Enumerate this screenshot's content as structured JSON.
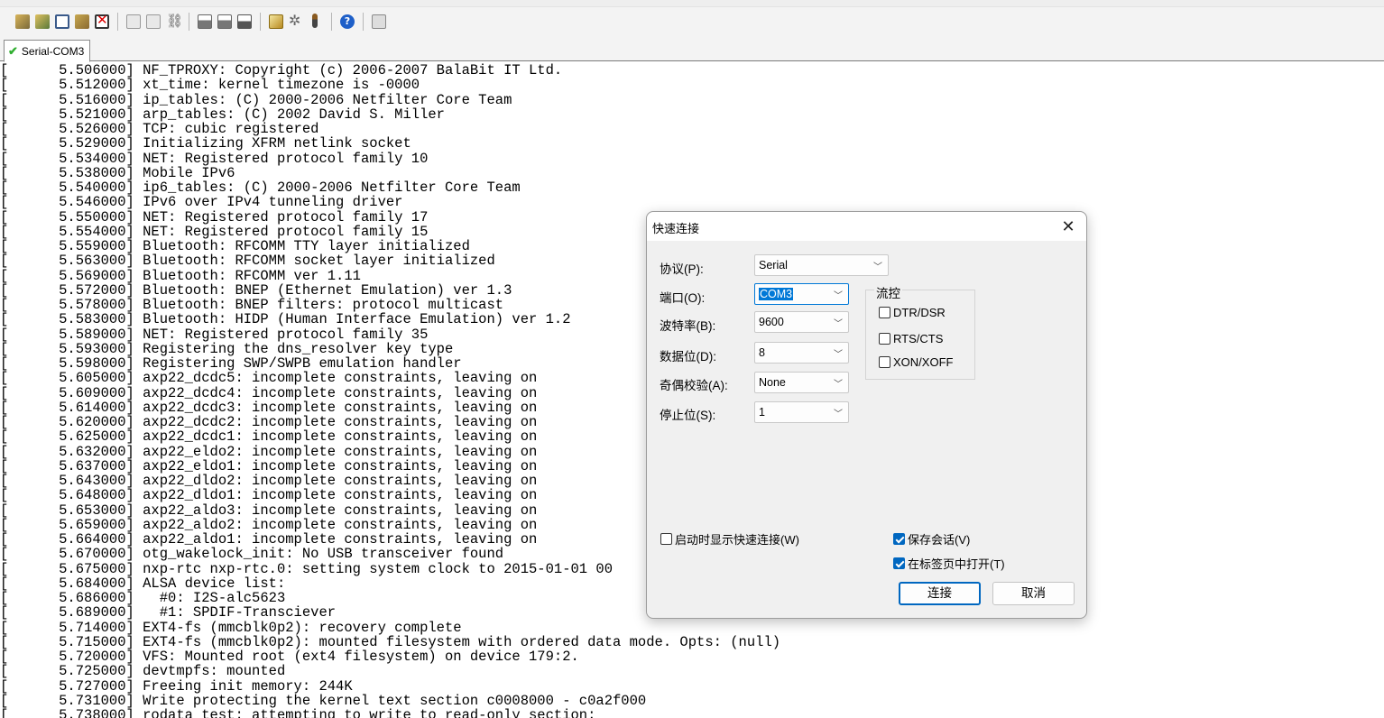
{
  "tab": {
    "label": "Serial-COM3"
  },
  "terminal": {
    "lines": [
      "[      5.506000] NF_TPROXY: Copyright (c) 2006-2007 BalaBit IT Ltd.",
      "[      5.512000] xt_time: kernel timezone is -0000",
      "[      5.516000] ip_tables: (C) 2000-2006 Netfilter Core Team",
      "[      5.521000] arp_tables: (C) 2002 David S. Miller",
      "[      5.526000] TCP: cubic registered",
      "[      5.529000] Initializing XFRM netlink socket",
      "[      5.534000] NET: Registered protocol family 10",
      "[      5.538000] Mobile IPv6",
      "[      5.540000] ip6_tables: (C) 2000-2006 Netfilter Core Team",
      "[      5.546000] IPv6 over IPv4 tunneling driver",
      "[      5.550000] NET: Registered protocol family 17",
      "[      5.554000] NET: Registered protocol family 15",
      "[      5.559000] Bluetooth: RFCOMM TTY layer initialized",
      "[      5.563000] Bluetooth: RFCOMM socket layer initialized",
      "[      5.569000] Bluetooth: RFCOMM ver 1.11",
      "[      5.572000] Bluetooth: BNEP (Ethernet Emulation) ver 1.3",
      "[      5.578000] Bluetooth: BNEP filters: protocol multicast",
      "[      5.583000] Bluetooth: HIDP (Human Interface Emulation) ver 1.2",
      "[      5.589000] NET: Registered protocol family 35",
      "[      5.593000] Registering the dns_resolver key type",
      "[      5.598000] Registering SWP/SWPB emulation handler",
      "[      5.605000] axp22_dcdc5: incomplete constraints, leaving on",
      "[      5.609000] axp22_dcdc4: incomplete constraints, leaving on",
      "[      5.614000] axp22_dcdc3: incomplete constraints, leaving on",
      "[      5.620000] axp22_dcdc2: incomplete constraints, leaving on",
      "[      5.625000] axp22_dcdc1: incomplete constraints, leaving on",
      "[      5.632000] axp22_eldo2: incomplete constraints, leaving on",
      "[      5.637000] axp22_eldo1: incomplete constraints, leaving on",
      "[      5.643000] axp22_dldo2: incomplete constraints, leaving on",
      "[      5.648000] axp22_dldo1: incomplete constraints, leaving on",
      "[      5.653000] axp22_aldo3: incomplete constraints, leaving on",
      "[      5.659000] axp22_aldo2: incomplete constraints, leaving on",
      "[      5.664000] axp22_aldo1: incomplete constraints, leaving on",
      "[      5.670000] otg_wakelock_init: No USB transceiver found",
      "[      5.675000] nxp-rtc nxp-rtc.0: setting system clock to 2015-01-01 00",
      "[      5.684000] ALSA device list:",
      "[      5.686000]   #0: I2S-alc5623",
      "[      5.689000]   #1: SPDIF-Transciever",
      "[      5.714000] EXT4-fs (mmcblk0p2): recovery complete",
      "[      5.715000] EXT4-fs (mmcblk0p2): mounted filesystem with ordered data mode. Opts: (null)",
      "[      5.720000] VFS: Mounted root (ext4 filesystem) on device 179:2.",
      "[      5.725000] devtmpfs: mounted",
      "[      5.727000] Freeing init memory: 244K",
      "[      5.731000] Write protecting the kernel text section c0008000 - c0a2f000",
      "[      5.738000] rodata_test: attempting to write to read-only section:"
    ]
  },
  "dialog": {
    "title": "快速连接",
    "fields": {
      "protocol": {
        "label": "协议(P):",
        "value": "Serial"
      },
      "port": {
        "label": "端口(O):",
        "value": "COM3"
      },
      "baud": {
        "label": "波特率(B):",
        "value": "9600"
      },
      "databits": {
        "label": "数据位(D):",
        "value": "8"
      },
      "parity": {
        "label": "奇偶校验(A):",
        "value": "None"
      },
      "stopbits": {
        "label": "停止位(S):",
        "value": "1"
      }
    },
    "flow_control": {
      "legend": "流控",
      "dtr": "DTR/DSR",
      "rts": "RTS/CTS",
      "xon": "XON/XOFF"
    },
    "show_on_startup": "启动时显示快速连接(W)",
    "save_session": "保存会话(V)",
    "open_in_tab": "在标签页中打开(T)",
    "connect_button": "连接",
    "cancel_button": "取消"
  },
  "colors": {
    "accent": "#0067c0",
    "selection": "#0078d7",
    "check_green": "#2fae2f"
  }
}
